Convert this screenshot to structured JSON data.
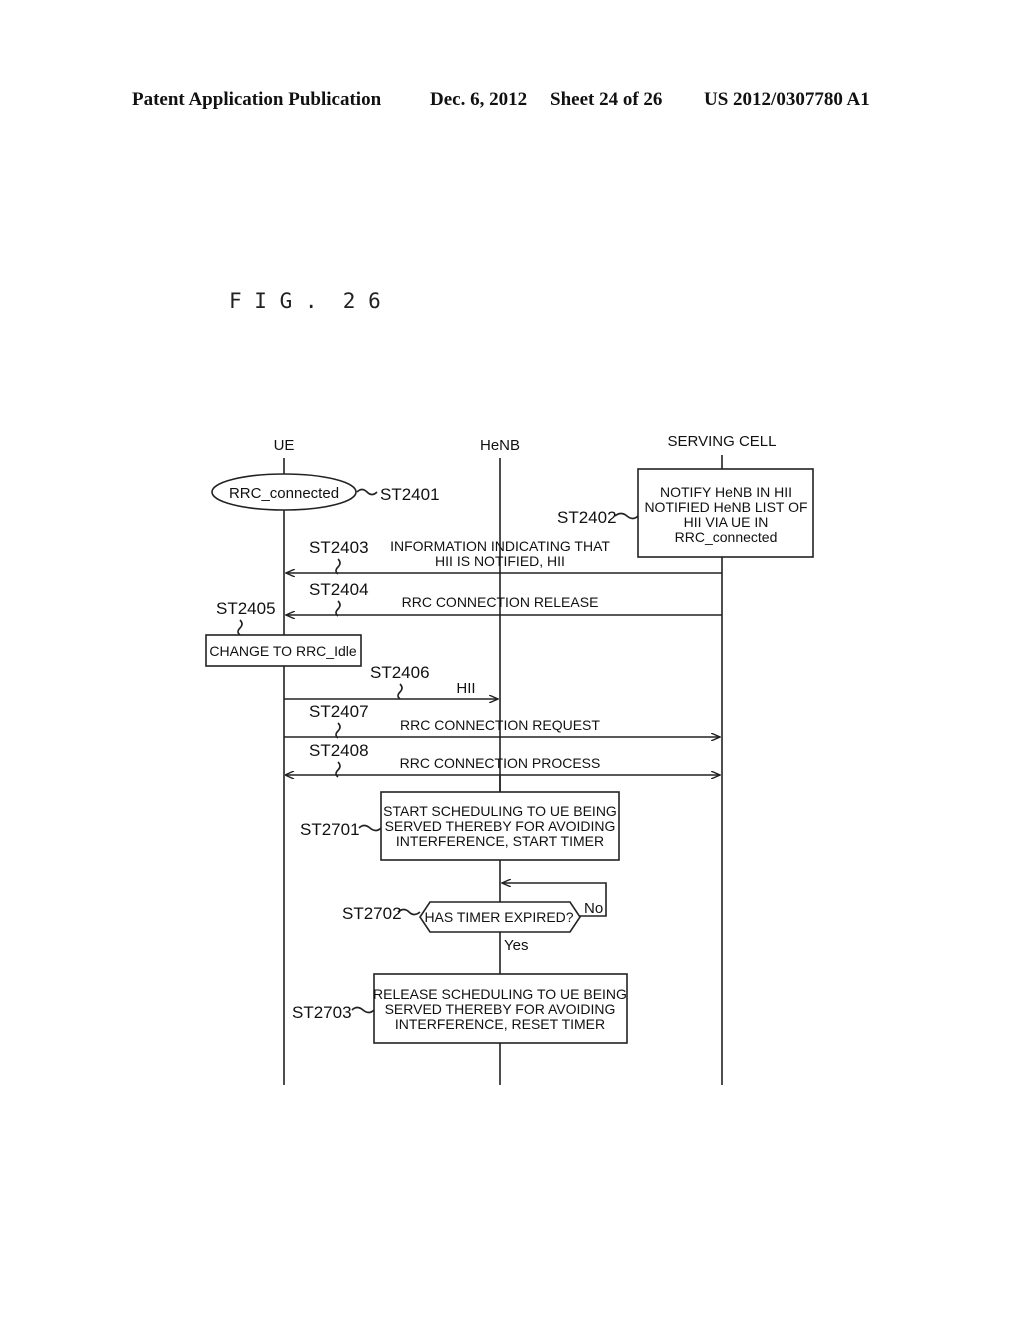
{
  "header": {
    "publication": "Patent Application Publication",
    "date": "Dec. 6, 2012",
    "sheet": "Sheet 24 of 26",
    "number": "US 2012/0307780 A1"
  },
  "figure": {
    "title": "F I G .  2 6"
  },
  "lifelines": {
    "ue": "UE",
    "henb": "HeNB",
    "serving_cell": "SERVING CELL"
  },
  "states": {
    "rrc_connected": {
      "label": "RRC_connected",
      "step": "ST2401"
    },
    "change_idle": {
      "label": "CHANGE TO RRC_Idle",
      "step": "ST2405"
    }
  },
  "serving_box": {
    "step": "ST2402",
    "lines": [
      "NOTIFY HeNB IN HII",
      "NOTIFIED HeNB LIST OF",
      "HII VIA UE IN",
      "RRC_connected"
    ]
  },
  "messages": [
    {
      "step": "ST2403",
      "lines": [
        "INFORMATION INDICATING THAT",
        "HII IS NOTIFIED, HII"
      ],
      "from": "SERVING CELL",
      "to": "UE"
    },
    {
      "step": "ST2404",
      "lines": [
        "RRC CONNECTION RELEASE"
      ],
      "from": "SERVING CELL",
      "to": "UE"
    },
    {
      "step": "ST2406",
      "lines": [
        "HII"
      ],
      "from": "UE",
      "to": "HeNB"
    },
    {
      "step": "ST2407",
      "lines": [
        "RRC CONNECTION REQUEST"
      ],
      "from": "UE",
      "to": "SERVING CELL"
    },
    {
      "step": "ST2408",
      "lines": [
        "RRC CONNECTION PROCESS"
      ],
      "from": "UE",
      "to": "SERVING CELL",
      "bidirectional": true
    }
  ],
  "flow": {
    "start": {
      "step": "ST2701",
      "lines": [
        "START SCHEDULING TO UE BEING",
        "SERVED THEREBY FOR AVOIDING",
        "INTERFERENCE, START TIMER"
      ]
    },
    "decision": {
      "step": "ST2702",
      "label": "HAS TIMER EXPIRED?",
      "no": "No",
      "yes": "Yes"
    },
    "release": {
      "step": "ST2703",
      "lines": [
        "RELEASE SCHEDULING TO UE BEING",
        "SERVED THEREBY FOR AVOIDING",
        "INTERFERENCE, RESET TIMER"
      ]
    }
  }
}
